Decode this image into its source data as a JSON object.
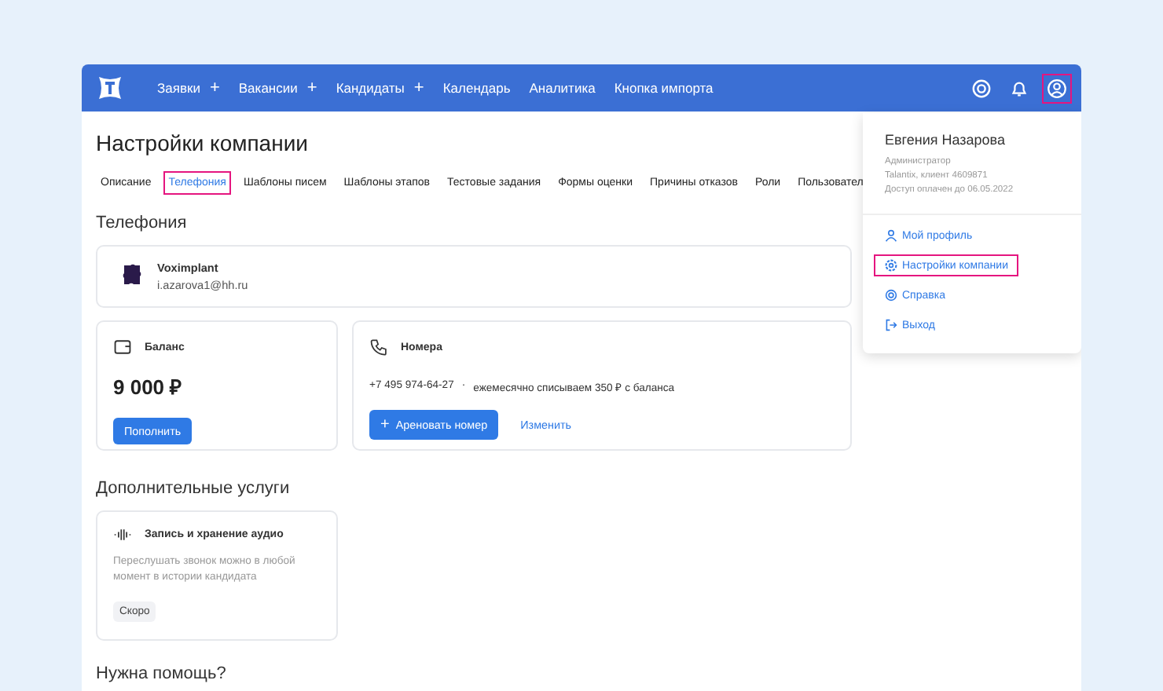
{
  "nav": {
    "items": [
      {
        "label": "Заявки",
        "add_sign": "+"
      },
      {
        "label": "Вакансии",
        "add_sign": "+"
      },
      {
        "label": "Кандидаты",
        "add_sign": "+"
      },
      {
        "label": "Календарь"
      },
      {
        "label": "Аналитика"
      },
      {
        "label": "Кнопка импорта"
      }
    ],
    "icons": [
      {
        "kind": "help",
        "highlighted": false
      },
      {
        "kind": "bell",
        "highlighted": false
      },
      {
        "kind": "user",
        "highlighted": true
      }
    ]
  },
  "page_title": "Настройки компании",
  "tabs": [
    {
      "label": "Описание",
      "selected": false,
      "highlighted": false
    },
    {
      "label": "Телефония",
      "selected": true,
      "highlighted": true
    },
    {
      "label": "Шаблоны писем",
      "selected": false,
      "highlighted": false
    },
    {
      "label": "Шаблоны этапов",
      "selected": false,
      "highlighted": false
    },
    {
      "label": "Тестовые задания",
      "selected": false,
      "highlighted": false
    },
    {
      "label": "Формы оценки",
      "selected": false,
      "highlighted": false
    },
    {
      "label": "Причины отказов",
      "selected": false,
      "highlighted": false
    },
    {
      "label": "Роли",
      "selected": false,
      "highlighted": false
    },
    {
      "label": "Пользовател",
      "selected": false,
      "highlighted": false
    }
  ],
  "telephony": {
    "heading": "Телефония",
    "provider": {
      "name": "Voximplant",
      "account": "i.azarova1@hh.ru"
    },
    "balance": {
      "title": "Баланс",
      "amount": "9 000 ₽",
      "button": "Пополнить"
    },
    "numbers": {
      "title": "Номера",
      "number": "+7 495 974-64-27",
      "separator": "·",
      "note": "ежемесячно списываем 350 ₽ с баланса",
      "rent_sign": "+",
      "rent_button": "Ареновать номер",
      "change_link": "Изменить"
    }
  },
  "extra": {
    "heading": "Дополнительные услуги",
    "card": {
      "title": "Запись и хранение аудио",
      "description": "Переслушать звонок можно в любой момент в истории кандидата",
      "badge": "Скоро"
    }
  },
  "help_heading": "Нужна помощь?",
  "profile_menu": {
    "name": "Евгения Назарова",
    "role": "Администратор",
    "client": "Talantix, клиент 4609871",
    "access": "Доступ оплачен до 06.05.2022",
    "items": [
      {
        "kind": "profile",
        "label": "Мой профиль",
        "highlighted": false
      },
      {
        "kind": "settings",
        "label": "Настройки компании",
        "highlighted": true
      },
      {
        "kind": "help",
        "label": "Справка",
        "highlighted": false
      },
      {
        "kind": "logout",
        "label": "Выход",
        "highlighted": false
      }
    ]
  }
}
